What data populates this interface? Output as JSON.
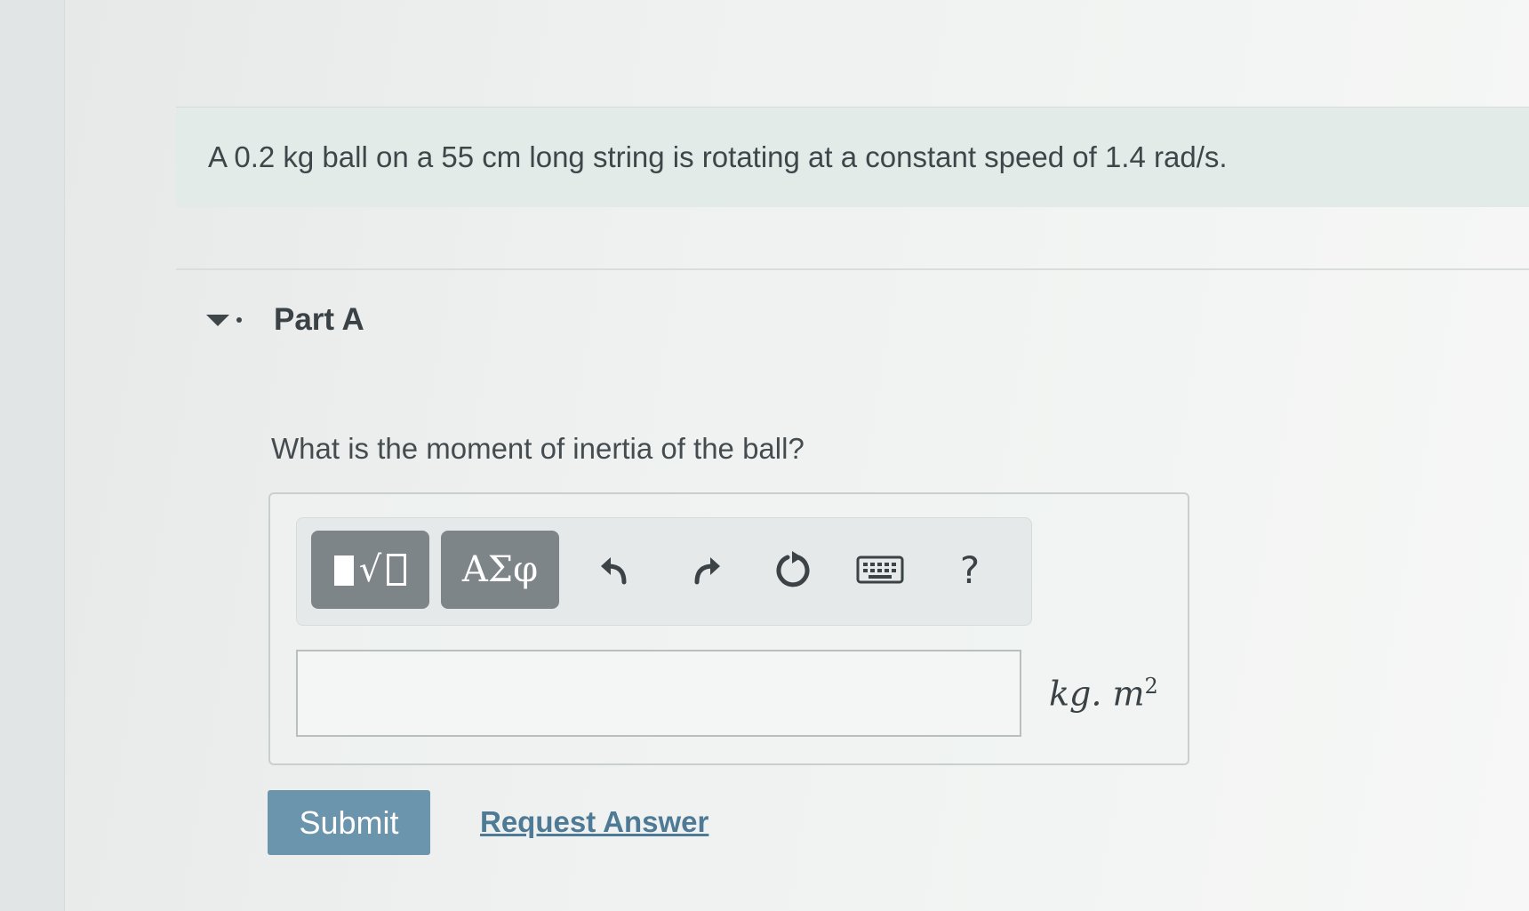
{
  "problem": {
    "statement": "A 0.2 kg ball on a 55 cm long string is rotating at a constant speed of 1.4 rad/s."
  },
  "part": {
    "title": "Part A",
    "question": "What is the moment of inertia of the ball?"
  },
  "toolbar": {
    "greek_label": "ΑΣφ",
    "help_label": "?",
    "icons": [
      "templates-icon",
      "undo-icon",
      "redo-icon",
      "reset-icon",
      "keyboard-icon"
    ]
  },
  "answer": {
    "value": "",
    "placeholder": "",
    "unit_base": "kg. m",
    "unit_exponent": "2"
  },
  "actions": {
    "submit_label": "Submit",
    "request_label": "Request Answer"
  },
  "colors": {
    "submit_bg": "#6b95ad",
    "link": "#4f7a96",
    "tool_button": "#7e8588"
  }
}
